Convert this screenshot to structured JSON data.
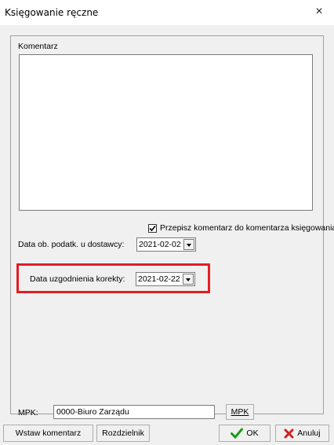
{
  "window": {
    "title": "Księgowanie ręczne",
    "close_label": "×"
  },
  "comment": {
    "group_label": "Komentarz",
    "value": ""
  },
  "copy_comment": {
    "label": "Przepisz komentarz do komentarza księgowania",
    "checked": true
  },
  "tax_date": {
    "label": "Data ob. podatk. u dostawcy:",
    "value": "2021-02-02"
  },
  "correction_date": {
    "label": "Data uzgodnienia korekty:",
    "value": "2021-02-22"
  },
  "mpk": {
    "label": "MPK:",
    "value": "0000-Biuro Zarządu",
    "button_label": "MPK"
  },
  "buttons": {
    "insert_comment": "Wstaw komentarz",
    "distributor": "Rozdzielnik",
    "ok": "OK",
    "cancel": "Anuluj"
  },
  "colors": {
    "highlight": "#e41c23",
    "ok_icon": "#1a9a1a",
    "cancel_icon": "#d42020"
  }
}
